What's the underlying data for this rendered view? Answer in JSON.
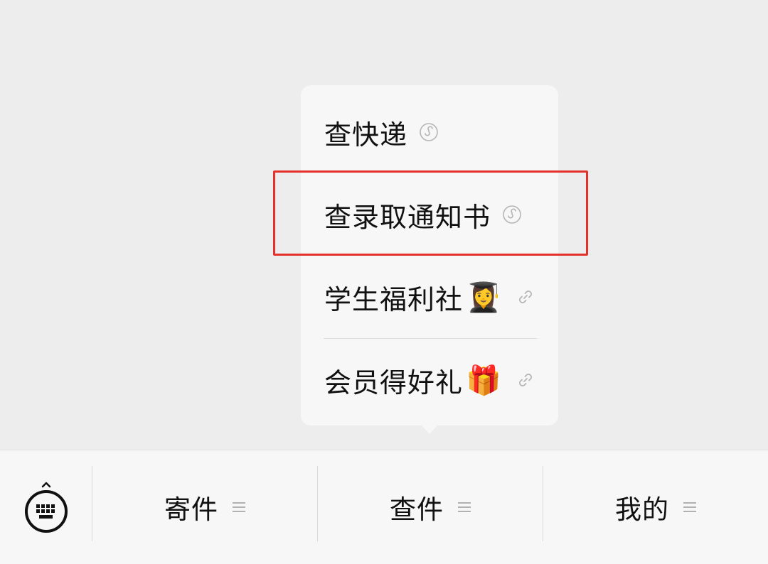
{
  "menu": {
    "items": [
      {
        "label": "查快递",
        "emoji": "",
        "icon": "mini-program-icon"
      },
      {
        "label": "查录取通知书",
        "emoji": "",
        "icon": "mini-program-icon"
      },
      {
        "label": "学生福利社",
        "emoji": "👩‍🎓",
        "icon": "link-icon"
      },
      {
        "label": "会员得好礼",
        "emoji": "🎁",
        "icon": "link-icon"
      }
    ]
  },
  "bottom_bar": {
    "keyboard_icon": "keyboard-icon",
    "tabs": [
      {
        "label": "寄件",
        "icon": "menu-lines-icon"
      },
      {
        "label": "查件",
        "icon": "menu-lines-icon"
      },
      {
        "label": "我的",
        "icon": "menu-lines-icon"
      }
    ]
  },
  "colors": {
    "background": "#ededed",
    "popup": "#f7f7f7",
    "highlight_border": "#e5312b",
    "text": "#111111"
  }
}
